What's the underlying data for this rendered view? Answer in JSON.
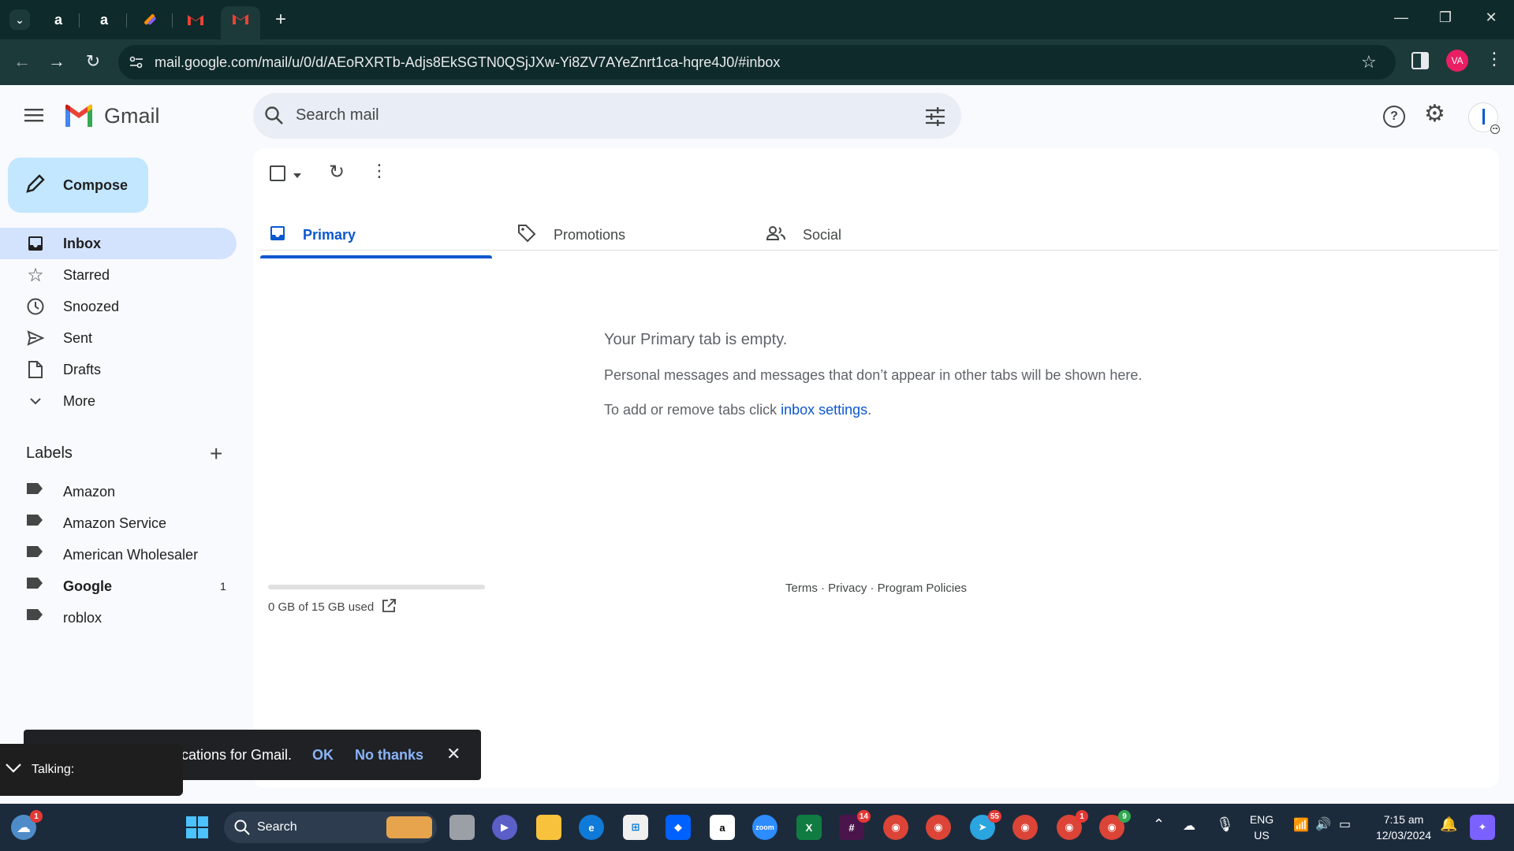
{
  "browser": {
    "url": "mail.google.com/mail/u/0/d/AEoRXRTb-Adjs8EkSGTN0QSjJXw-Yi8ZV7AYeZnrt1ca-hqre4J0/#inbox",
    "profile_initials": "VA"
  },
  "gmail": {
    "logo_text": "Gmail",
    "search_placeholder": "Search mail",
    "compose_label": "Compose",
    "nav": [
      {
        "label": "Inbox",
        "icon": "inbox-icon"
      },
      {
        "label": "Starred",
        "icon": "star-icon"
      },
      {
        "label": "Snoozed",
        "icon": "clock-icon"
      },
      {
        "label": "Sent",
        "icon": "send-icon"
      },
      {
        "label": "Drafts",
        "icon": "draft-icon"
      },
      {
        "label": "More",
        "icon": "chevron-down-icon"
      }
    ],
    "labels_title": "Labels",
    "labels": [
      {
        "name": "Amazon",
        "count": ""
      },
      {
        "name": "Amazon Service",
        "count": ""
      },
      {
        "name": "American Wholesaler",
        "count": ""
      },
      {
        "name": "Google",
        "count": "1"
      },
      {
        "name": "roblox",
        "count": ""
      }
    ],
    "tabs": [
      "Primary",
      "Promotions",
      "Social"
    ],
    "empty": {
      "title": "Your Primary tab is empty.",
      "line1": "Personal messages and messages that don’t appear in other tabs will be shown here.",
      "line2_prefix": "To add or remove tabs click ",
      "line2_link": "inbox settings",
      "line2_suffix": "."
    },
    "storage": "0 GB of 15 GB used",
    "storage_fraction": 0.0,
    "footer_links": "Terms · Privacy · Program Policies",
    "toast": {
      "text": "cations for Gmail.",
      "ok": "OK",
      "no_thanks": "No thanks"
    },
    "talking": "Talking:"
  },
  "taskbar": {
    "search_placeholder": "Search",
    "lang_top": "ENG",
    "lang_bottom": "US",
    "time": "7:15 am",
    "date": "12/03/2024",
    "badges": {
      "widgets": "1",
      "slack": "14",
      "telegram": "55",
      "chrome3": "1",
      "chrome4": "9"
    }
  }
}
